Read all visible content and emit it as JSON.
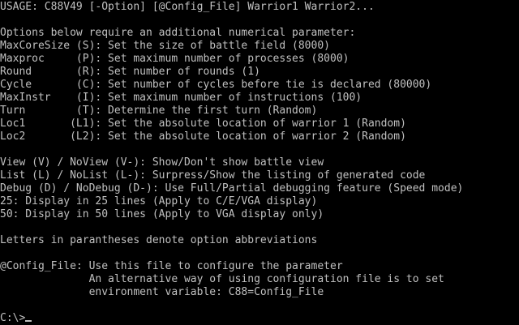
{
  "colors": {
    "background": "#000000",
    "foreground": "#c0c0c0"
  },
  "terminal": {
    "lines": [
      "USAGE: C88V49 [-Option] [@Config_File] Warrior1 Warrior2...",
      "",
      "Options below require an additional numerical parameter:",
      "MaxCoreSize (S): Set the size of battle field (8000)",
      "Maxproc     (P): Set maximum number of processes (8000)",
      "Round       (R): Set number of rounds (1)",
      "Cycle       (C): Set number of cycles before tie is declared (80000)",
      "MaxInstr    (I): Set maximum number of instructions (100)",
      "Turn        (T): Determine the first turn (Random)",
      "Loc1       (L1): Set the absolute location of warrior 1 (Random)",
      "Loc2       (L2): Set the absolute location of warrior 2 (Random)",
      "",
      "View (V) / NoView (V-): Show/Don't show battle view",
      "List (L) / NoList (L-): Surpress/Show the listing of generated code",
      "Debug (D) / NoDebug (D-): Use Full/Partial debugging feature (Speed mode)",
      "25: Display in 25 lines (Apply to C/E/VGA display)",
      "50: Display in 50 lines (Apply to VGA display only)",
      "",
      "Letters in parantheses denote option abbreviations",
      "",
      "@Config_File: Use this file to configure the parameter",
      "              An alternative way of using configuration file is to set",
      "              environment variable: C88=Config_File",
      "",
      ""
    ],
    "prompt": "C:\\>"
  }
}
